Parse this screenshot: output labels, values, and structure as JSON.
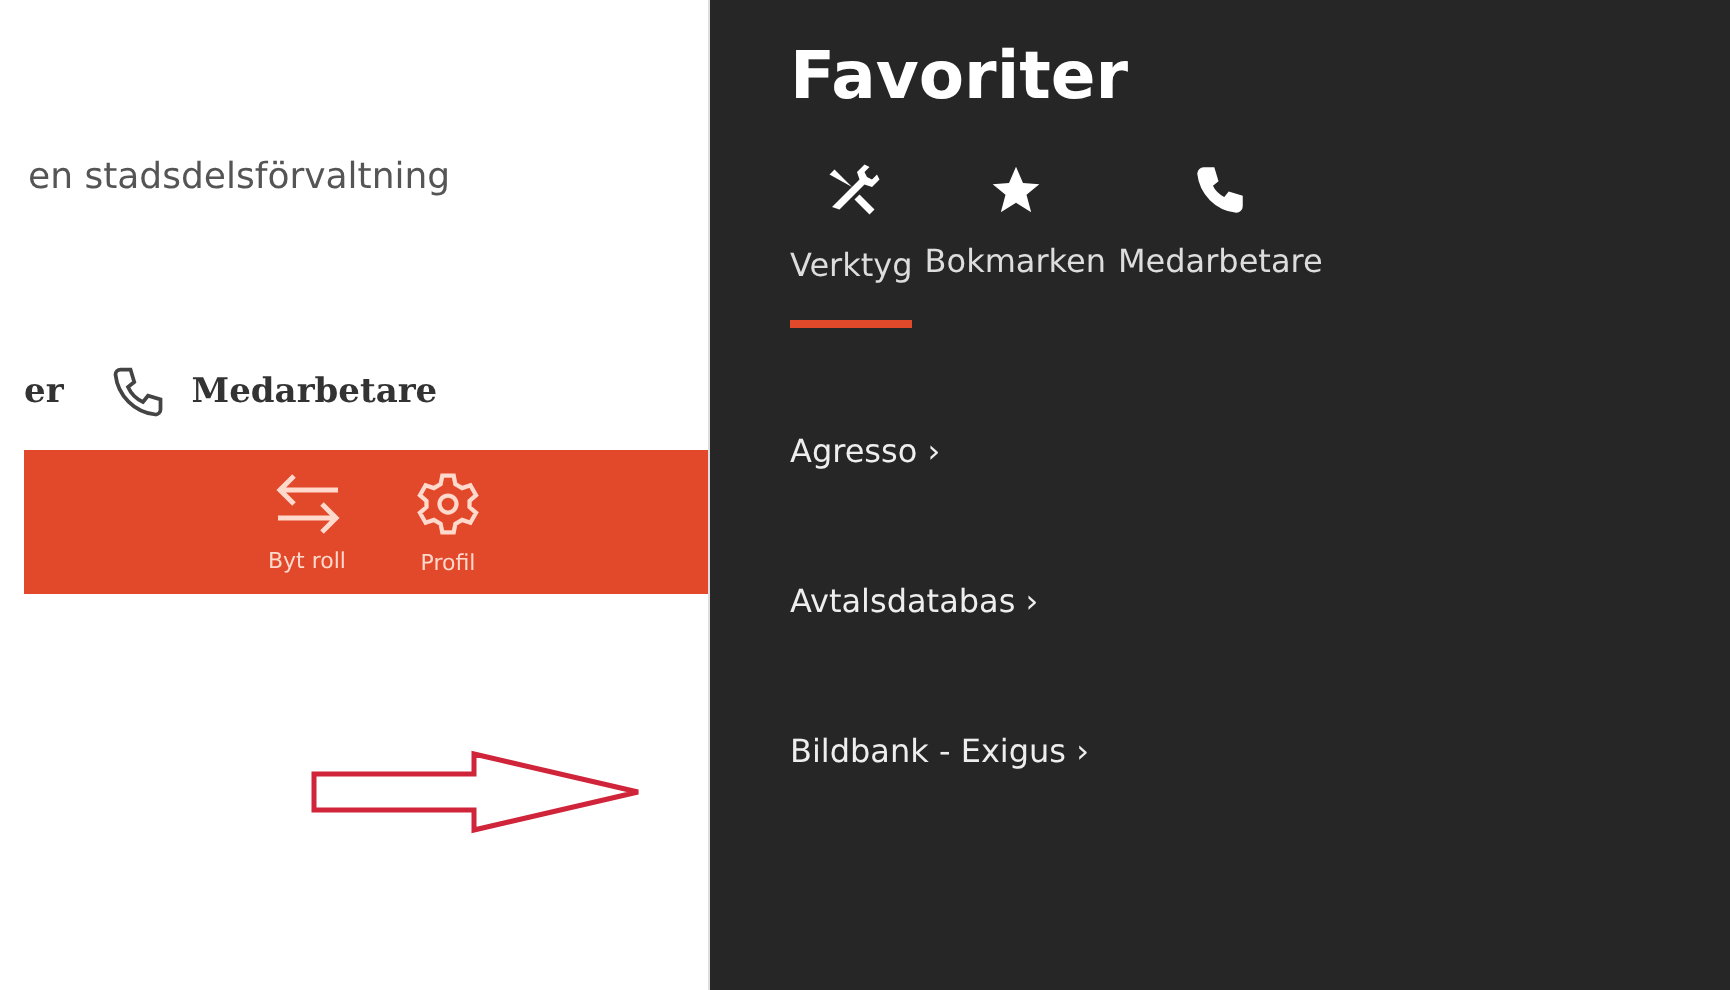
{
  "page": {
    "org_name": "en stadsdelsförvaltning",
    "nav": [
      {
        "kind": "text",
        "label": "er"
      },
      {
        "kind": "phone",
        "label": "Medarbetare"
      }
    ],
    "toolbar": [
      {
        "kind": "swap",
        "label": "Byt roll"
      },
      {
        "kind": "gear",
        "label": "Profil"
      }
    ]
  },
  "favorites": {
    "title": "Favoriter",
    "tabs": [
      {
        "kind": "tools",
        "label": "Verktyg",
        "selected": true
      },
      {
        "kind": "star",
        "label": "Bokmarken",
        "selected": false
      },
      {
        "kind": "phone",
        "label": "Medarbetare",
        "selected": false
      }
    ],
    "items": [
      "Agresso ›",
      "Avtalsdatabas ›",
      "Bildbank - Exigus ›"
    ]
  }
}
